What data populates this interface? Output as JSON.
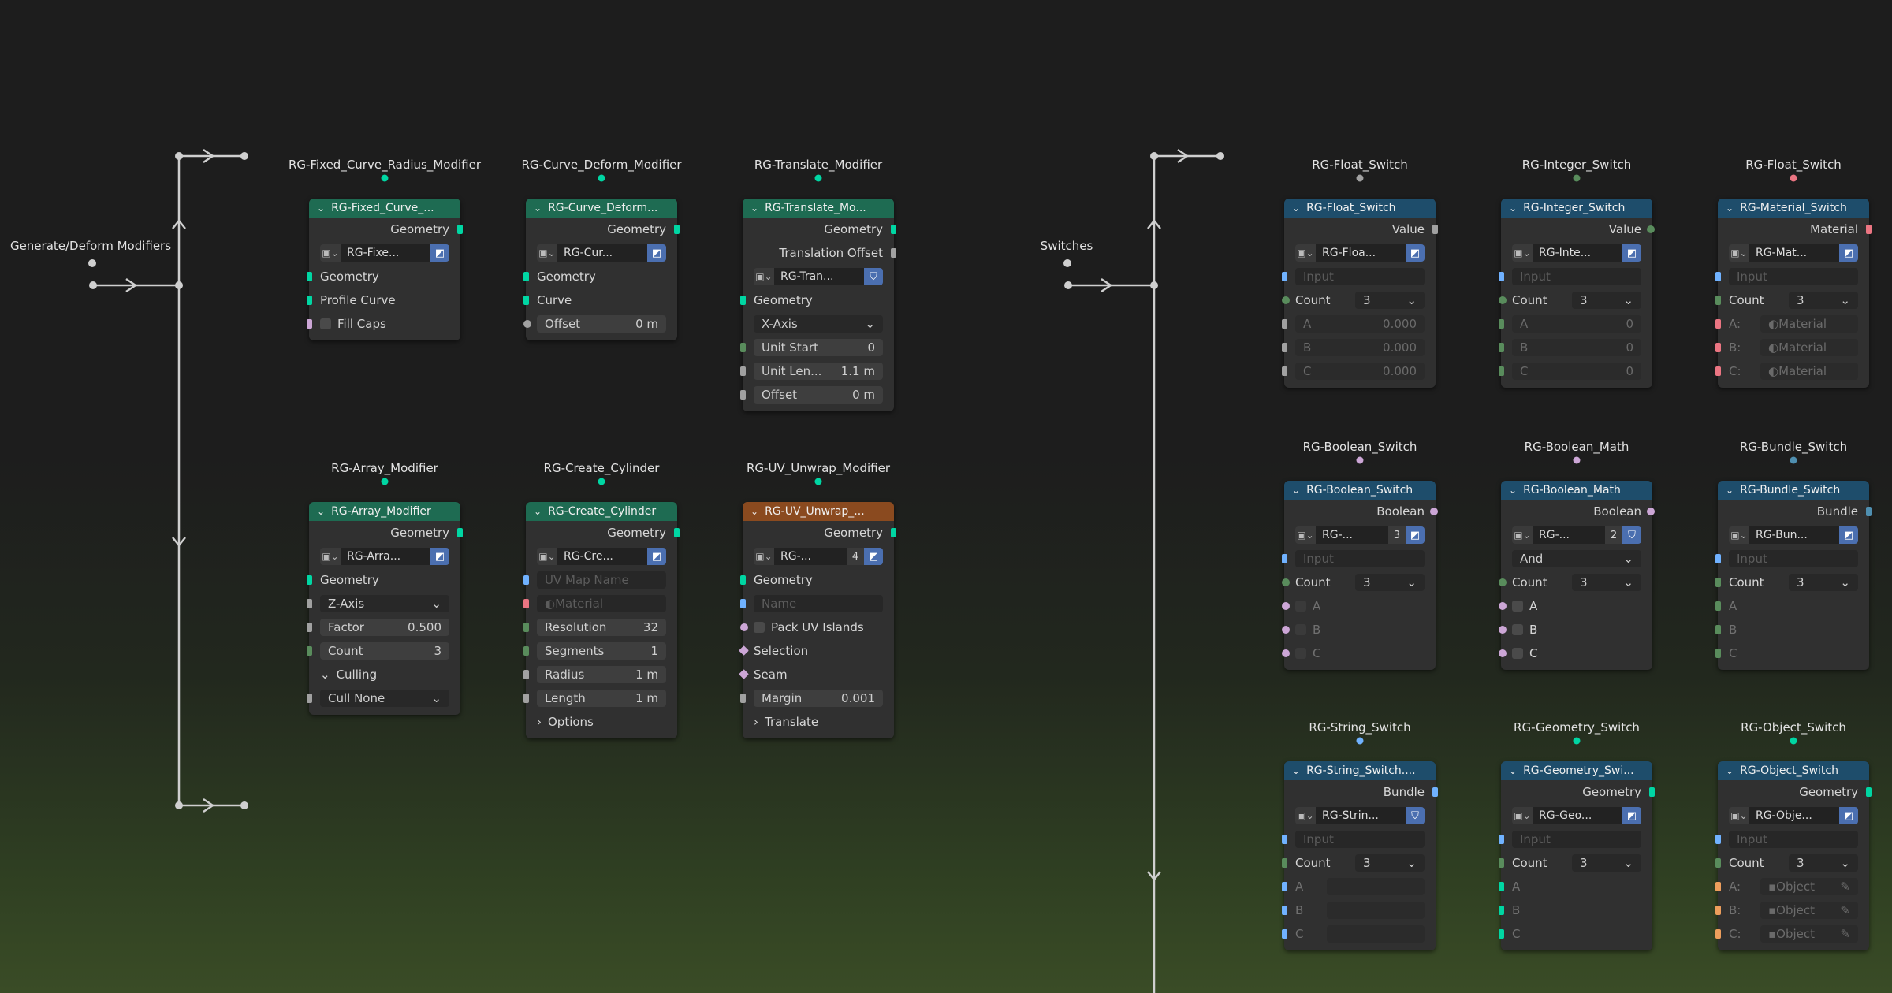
{
  "groups": {
    "left": {
      "label": "Generate/Deform Modifiers"
    },
    "right": {
      "label": "Switches"
    }
  },
  "colors": {
    "geometry": "#00d6a3",
    "float": "#a1a1a1",
    "int": "#598c5c",
    "bool": "#cca6d6",
    "vector": "#6363c7",
    "string": "#70b2ff",
    "material": "#eb7582",
    "object": "#ed9e5c",
    "bundle": "#4f8fb0",
    "header_green": "#1e6b52",
    "header_blue": "#1e4d6b",
    "header_orange": "#8a4a1f"
  },
  "nodes": [
    {
      "id": "n1",
      "title": "RG-Fixed_Curve_Radius_Modifier",
      "header": "RG-Fixed_Curve_...",
      "color": "green",
      "rows": [
        {
          "t": "out",
          "label": "Geometry",
          "s": "geometry"
        },
        {
          "t": "group",
          "name": "RG-Fixe...",
          "btn": "◩"
        },
        {
          "t": "in",
          "label": "Geometry",
          "s": "geometry"
        },
        {
          "t": "in",
          "label": "Profile Curve",
          "s": "geometry"
        },
        {
          "t": "check",
          "label": "Fill Caps",
          "s": "bool"
        }
      ]
    },
    {
      "id": "n2",
      "title": "RG-Curve_Deform_Modifier",
      "header": "RG-Curve_Deform...",
      "color": "green",
      "rows": [
        {
          "t": "out",
          "label": "Geometry",
          "s": "geometry"
        },
        {
          "t": "group",
          "name": "RG-Cur...",
          "btn": "◩"
        },
        {
          "t": "in",
          "label": "Geometry",
          "s": "geometry"
        },
        {
          "t": "in",
          "label": "Curve",
          "s": "geometry"
        },
        {
          "t": "field",
          "label": "Offset",
          "value": "0 m",
          "s": "float",
          "sh": "c"
        }
      ]
    },
    {
      "id": "n3",
      "title": "RG-Translate_Modifier",
      "header": "RG-Translate_Mo...",
      "color": "green",
      "rows": [
        {
          "t": "out",
          "label": "Geometry",
          "s": "geometry"
        },
        {
          "t": "out",
          "label": "Translation Offset",
          "s": "float"
        },
        {
          "t": "group",
          "name": "RG-Tran...",
          "btn": "⛉"
        },
        {
          "t": "in",
          "label": "Geometry",
          "s": "geometry"
        },
        {
          "t": "dropdown",
          "value": "X-Axis"
        },
        {
          "t": "field",
          "label": "Unit Start",
          "value": "0",
          "s": "int"
        },
        {
          "t": "field",
          "label": "Unit Len...",
          "value": "1.1 m",
          "s": "float"
        },
        {
          "t": "field",
          "label": "Offset",
          "value": "0 m",
          "s": "float"
        }
      ]
    },
    {
      "id": "n4",
      "title": "RG-Array_Modifier",
      "header": "RG-Array_Modifier",
      "color": "green",
      "rows": [
        {
          "t": "out",
          "label": "Geometry",
          "s": "geometry"
        },
        {
          "t": "group",
          "name": "RG-Arra...",
          "btn": "◩"
        },
        {
          "t": "in",
          "label": "Geometry",
          "s": "geometry"
        },
        {
          "t": "dropdown",
          "value": "Z-Axis",
          "s": "float"
        },
        {
          "t": "field",
          "label": "Factor",
          "value": "0.500",
          "s": "float"
        },
        {
          "t": "field",
          "label": "Count",
          "value": "3",
          "s": "int"
        },
        {
          "t": "panel",
          "label": "Culling",
          "open": true
        },
        {
          "t": "dropdown",
          "value": "Cull None",
          "s": "float"
        }
      ]
    },
    {
      "id": "n5",
      "title": "RG-Create_Cylinder",
      "header": "RG-Create_Cylinder",
      "color": "green",
      "rows": [
        {
          "t": "out",
          "label": "Geometry",
          "s": "geometry"
        },
        {
          "t": "group",
          "name": "RG-Cre...",
          "btn": "◩"
        },
        {
          "t": "placeholder",
          "value": "UV Map Name",
          "s": "string"
        },
        {
          "t": "material",
          "value": "Material",
          "s": "material"
        },
        {
          "t": "field",
          "label": "Resolution",
          "value": "32",
          "s": "int"
        },
        {
          "t": "field",
          "label": "Segments",
          "value": "1",
          "s": "int"
        },
        {
          "t": "field",
          "label": "Radius",
          "value": "1 m",
          "s": "float"
        },
        {
          "t": "field",
          "label": "Length",
          "value": "1 m",
          "s": "float"
        },
        {
          "t": "panel",
          "label": "Options",
          "open": false
        }
      ]
    },
    {
      "id": "n6",
      "title": "RG-UV_Unwrap_Modifier",
      "header": "RG-UV_Unwrap_...",
      "color": "orange",
      "rows": [
        {
          "t": "out",
          "label": "Geometry",
          "s": "geometry"
        },
        {
          "t": "group",
          "name": "RG-...",
          "num": "4",
          "btn": "◩"
        },
        {
          "t": "in",
          "label": "Geometry",
          "s": "geometry"
        },
        {
          "t": "placeholder",
          "value": "Name",
          "s": "string"
        },
        {
          "t": "check",
          "label": "Pack UV Islands",
          "s": "bool",
          "sh": "c"
        },
        {
          "t": "in",
          "label": "Selection",
          "s": "bool",
          "sh": "dm"
        },
        {
          "t": "in",
          "label": "Seam",
          "s": "bool",
          "sh": "dm"
        },
        {
          "t": "field",
          "label": "Margin",
          "value": "0.001",
          "s": "float"
        },
        {
          "t": "panel",
          "label": "Translate",
          "open": false
        }
      ]
    },
    {
      "id": "s1",
      "title": "RG-Float_Switch",
      "header": "RG-Float_Switch",
      "color": "blue",
      "rows": [
        {
          "t": "out",
          "label": "Value",
          "s": "float"
        },
        {
          "t": "group",
          "name": "RG-Floa...",
          "btn": "◩"
        },
        {
          "t": "placeholder",
          "value": "Input",
          "s": "string"
        },
        {
          "t": "count",
          "label": "Count",
          "value": "3",
          "s": "int",
          "sh": "c"
        },
        {
          "t": "field",
          "label": "A",
          "value": "0.000",
          "s": "float",
          "dim": true
        },
        {
          "t": "field",
          "label": "B",
          "value": "0.000",
          "s": "float",
          "dim": true
        },
        {
          "t": "field",
          "label": "C",
          "value": "0.000",
          "s": "float",
          "dim": true
        }
      ]
    },
    {
      "id": "s2",
      "title": "RG-Integer_Switch",
      "header": "RG-Integer_Switch",
      "color": "blue",
      "rows": [
        {
          "t": "out",
          "label": "Value",
          "s": "int",
          "sh": "c"
        },
        {
          "t": "group",
          "name": "RG-Inte...",
          "btn": "◩"
        },
        {
          "t": "placeholder",
          "value": "Input",
          "s": "string"
        },
        {
          "t": "count",
          "label": "Count",
          "value": "3",
          "s": "int",
          "sh": "c"
        },
        {
          "t": "field",
          "label": "A",
          "value": "0",
          "s": "int",
          "dim": true
        },
        {
          "t": "field",
          "label": "B",
          "value": "0",
          "s": "int",
          "dim": true
        },
        {
          "t": "field",
          "label": "C",
          "value": "0",
          "s": "int",
          "dim": true
        }
      ]
    },
    {
      "id": "s3",
      "title": "RG-Float_Switch",
      "header": "RG-Material_Switch",
      "color": "blue",
      "rows": [
        {
          "t": "out",
          "label": "Material",
          "s": "material"
        },
        {
          "t": "group",
          "name": "RG-Mat...",
          "btn": "◩"
        },
        {
          "t": "placeholder",
          "value": "Input",
          "s": "string"
        },
        {
          "t": "count",
          "label": "Count",
          "value": "3",
          "s": "int"
        },
        {
          "t": "material",
          "label": "A:",
          "value": "Material",
          "s": "material",
          "dim": true
        },
        {
          "t": "material",
          "label": "B:",
          "value": "Material",
          "s": "material",
          "dim": true
        },
        {
          "t": "material",
          "label": "C:",
          "value": "Material",
          "s": "material",
          "dim": true
        }
      ]
    },
    {
      "id": "s4",
      "title": "RG-Boolean_Switch",
      "header": "RG-Boolean_Switch",
      "color": "blue",
      "rows": [
        {
          "t": "out",
          "label": "Boolean",
          "s": "bool",
          "sh": "c"
        },
        {
          "t": "group",
          "name": "RG-...",
          "num": "3",
          "btn": "◩"
        },
        {
          "t": "placeholder",
          "value": "Input",
          "s": "string"
        },
        {
          "t": "count",
          "label": "Count",
          "value": "3",
          "s": "int",
          "sh": "c"
        },
        {
          "t": "check",
          "label": "A",
          "s": "bool",
          "sh": "c",
          "dim": true
        },
        {
          "t": "check",
          "label": "B",
          "s": "bool",
          "sh": "c",
          "dim": true
        },
        {
          "t": "check",
          "label": "C",
          "s": "bool",
          "sh": "c",
          "dim": true
        }
      ]
    },
    {
      "id": "s5",
      "title": "RG-Boolean_Math",
      "header": "RG-Boolean_Math",
      "color": "blue",
      "rows": [
        {
          "t": "out",
          "label": "Boolean",
          "s": "bool",
          "sh": "c"
        },
        {
          "t": "group",
          "name": "RG-...",
          "num": "2",
          "btn": "⛉"
        },
        {
          "t": "dropdown",
          "value": "And"
        },
        {
          "t": "count",
          "label": "Count",
          "value": "3",
          "s": "int",
          "sh": "c"
        },
        {
          "t": "check",
          "label": "A",
          "s": "bool",
          "sh": "c"
        },
        {
          "t": "check",
          "label": "B",
          "s": "bool",
          "sh": "c"
        },
        {
          "t": "check",
          "label": "C",
          "s": "bool",
          "sh": "c"
        }
      ]
    },
    {
      "id": "s6",
      "title": "RG-Bundle_Switch",
      "header": "RG-Bundle_Switch",
      "color": "blue",
      "rows": [
        {
          "t": "out",
          "label": "Bundle",
          "s": "bundle"
        },
        {
          "t": "group",
          "name": "RG-Bun...",
          "btn": "◩"
        },
        {
          "t": "placeholder",
          "value": "Input",
          "s": "string"
        },
        {
          "t": "count",
          "label": "Count",
          "value": "3",
          "s": "int"
        },
        {
          "t": "in",
          "label": "A",
          "s": "int",
          "dim": true
        },
        {
          "t": "in",
          "label": "B",
          "s": "int",
          "dim": true
        },
        {
          "t": "in",
          "label": "C",
          "s": "int",
          "dim": true
        }
      ]
    },
    {
      "id": "s7",
      "title": "RG-String_Switch",
      "header": "RG-String_Switch....",
      "color": "blue",
      "rows": [
        {
          "t": "out",
          "label": "Bundle",
          "s": "string"
        },
        {
          "t": "group",
          "name": "RG-Strin...",
          "btn": "⛉"
        },
        {
          "t": "placeholder",
          "value": "Input",
          "s": "string"
        },
        {
          "t": "count",
          "label": "Count",
          "value": "3",
          "s": "int"
        },
        {
          "t": "blank",
          "label": "A",
          "s": "string",
          "dim": true
        },
        {
          "t": "blank",
          "label": "B",
          "s": "string",
          "dim": true
        },
        {
          "t": "blank",
          "label": "C",
          "s": "string",
          "dim": true
        }
      ]
    },
    {
      "id": "s8",
      "title": "RG-Geometry_Switch",
      "header": "RG-Geometry_Swi...",
      "color": "blue",
      "rows": [
        {
          "t": "out",
          "label": "Geometry",
          "s": "geometry"
        },
        {
          "t": "group",
          "name": "RG-Geo...",
          "btn": "◩"
        },
        {
          "t": "placeholder",
          "value": "Input",
          "s": "string"
        },
        {
          "t": "count",
          "label": "Count",
          "value": "3",
          "s": "int"
        },
        {
          "t": "in",
          "label": "A",
          "s": "geometry",
          "dim": true
        },
        {
          "t": "in",
          "label": "B",
          "s": "geometry",
          "dim": true
        },
        {
          "t": "in",
          "label": "C",
          "s": "geometry",
          "dim": true
        }
      ]
    },
    {
      "id": "s9",
      "title": "RG-Object_Switch",
      "header": "RG-Object_Switch",
      "color": "blue",
      "rows": [
        {
          "t": "out",
          "label": "Geometry",
          "s": "geometry"
        },
        {
          "t": "group",
          "name": "RG-Obje...",
          "btn": "◩"
        },
        {
          "t": "placeholder",
          "value": "Input",
          "s": "string"
        },
        {
          "t": "count",
          "label": "Count",
          "value": "3",
          "s": "int"
        },
        {
          "t": "object",
          "label": "A:",
          "value": "Object",
          "s": "object",
          "dim": true
        },
        {
          "t": "object",
          "label": "B:",
          "value": "Object",
          "s": "object",
          "dim": true
        },
        {
          "t": "object",
          "label": "C:",
          "value": "Object",
          "s": "object",
          "dim": true
        }
      ]
    }
  ]
}
